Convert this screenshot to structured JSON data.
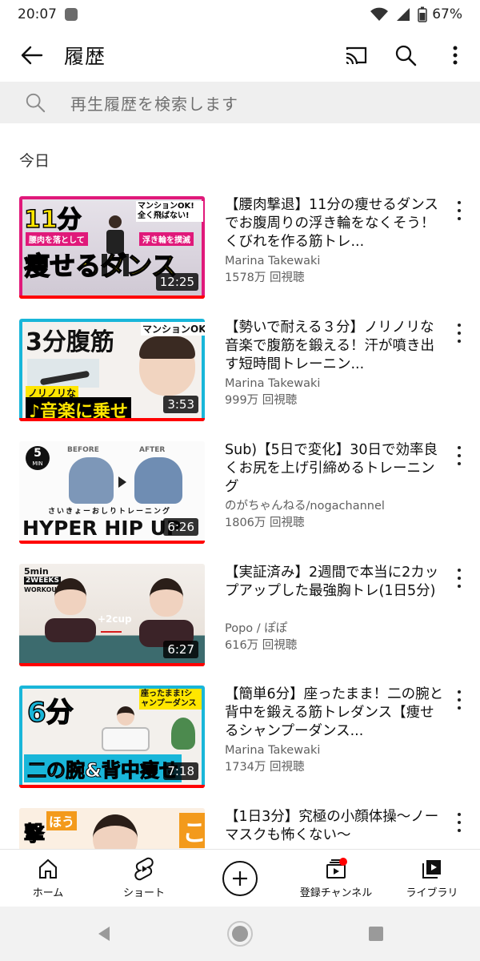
{
  "status": {
    "time": "20:07",
    "battery": "67%"
  },
  "app_bar": {
    "title": "履歴"
  },
  "search": {
    "placeholder": "再生履歴を検索します"
  },
  "section": {
    "label": "今日"
  },
  "videos": [
    {
      "title": "【腰肉撃退】11分の痩せるダンスでお腹周りの浮き輪をなくそう！くびれを作る筋トレ...",
      "channel": "Marina Takewaki",
      "views": "1578万 回視聴",
      "duration": "12:25",
      "progress": 1.0,
      "thumb_text": [
        "11分",
        "マンションOK!全く飛ばない!",
        "腰肉を落として",
        "浮き輪を撲滅",
        "痩せるダンス"
      ]
    },
    {
      "title": "【勢いで耐える３分】ノリノリな音楽で腹筋を鍛える！汗が噴き出す短時間トレーニン...",
      "channel": "Marina Takewaki",
      "views": "999万 回視聴",
      "duration": "3:53",
      "progress": 1.0,
      "thumb_text": [
        "3分腹筋",
        "マンションOK",
        "ノリノリな",
        "♪音楽に乗せ"
      ]
    },
    {
      "title": "Sub)【5日で変化】30日で効率良くお尻を上げ引締めるトレーニング",
      "channel": "のがちゃんねる/nogachannel",
      "views": "1806万 回視聴",
      "duration": "6:26",
      "progress": 1.0,
      "thumb_text": [
        "5",
        "MIN",
        "BEFORE",
        "AFTER",
        "さいきょーおしりトレーニング",
        "HYPER HIP UP"
      ]
    },
    {
      "title": "【実証済み】2週間で本当に2カップアップした最強胸トレ(1日5分)",
      "channel": "Popo / ぽぽ",
      "views": "616万 回視聴",
      "duration": "6:27",
      "progress": 1.0,
      "thumb_text": [
        "5min",
        "2WEEKS",
        "WORKOUT",
        "+2cup"
      ]
    },
    {
      "title": "【簡単6分】座ったまま！二の腕と背中を鍛える筋トレダンス【痩せるシャンプーダンス...",
      "channel": "Marina Takewaki",
      "views": "1734万 回視聴",
      "duration": "7:18",
      "progress": 1.0,
      "thumb_text": [
        "6分",
        "座ったまま!シャンプーダンス",
        "二の腕&背中痩せ"
      ]
    },
    {
      "title": "【1日3分】究極の小顔体操〜ノーマスクも怖くない〜",
      "channel": "",
      "views": "",
      "duration": "",
      "progress": 0,
      "thumb_text": [
        "撃",
        "ほう",
        "こ"
      ]
    }
  ],
  "bottom_nav": [
    {
      "label": "ホーム",
      "icon": "home-icon"
    },
    {
      "label": "ショート",
      "icon": "shorts-icon"
    },
    {
      "label": "",
      "icon": "create-plus-icon"
    },
    {
      "label": "登録チャンネル",
      "icon": "subscriptions-icon"
    },
    {
      "label": "ライブラリ",
      "icon": "library-icon"
    }
  ],
  "colors": {
    "progress": "#ff0000",
    "accent_yellow": "#ffe600",
    "accent_magenta": "#e0197a"
  }
}
